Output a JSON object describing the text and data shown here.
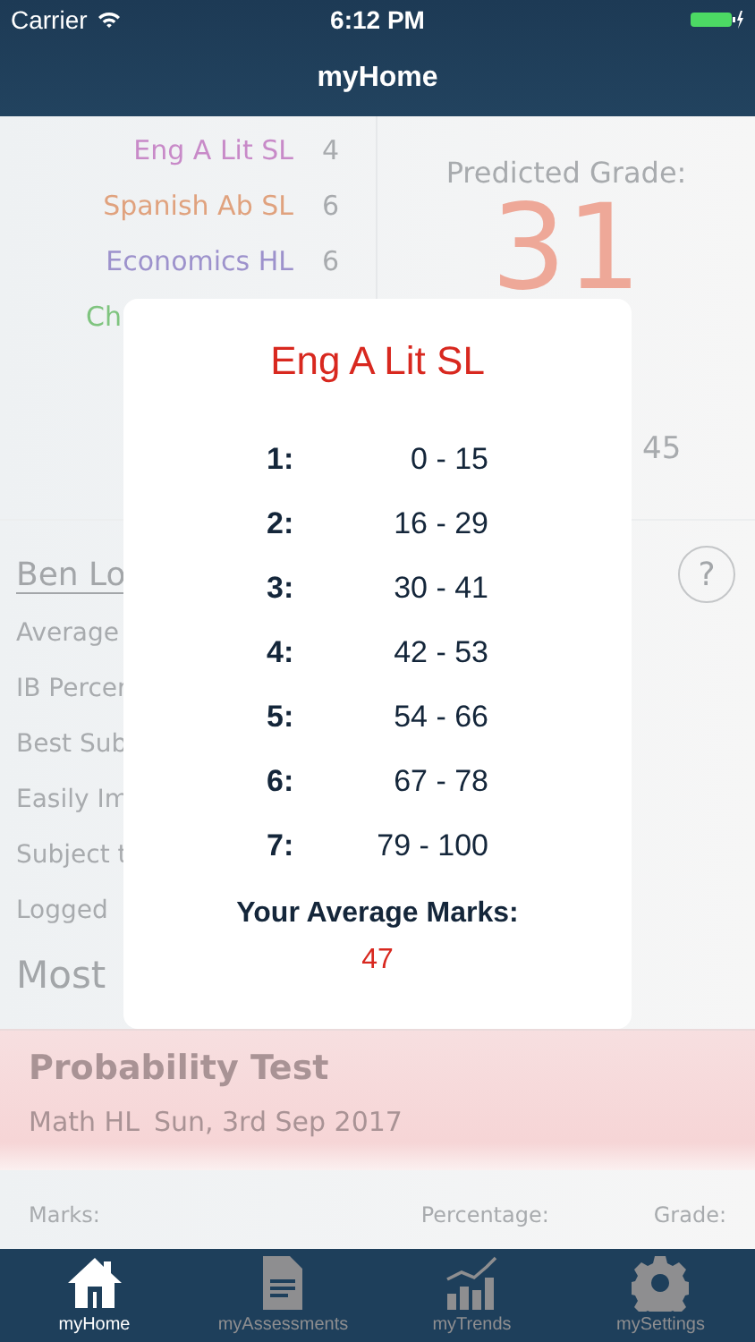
{
  "status_bar": {
    "carrier": "Carrier",
    "time": "6:12 PM"
  },
  "nav": {
    "title": "myHome"
  },
  "subjects": [
    {
      "name": "Eng A Lit SL",
      "grade": "4",
      "color": "#c88ac8"
    },
    {
      "name": "Spanish Ab SL",
      "grade": "6",
      "color": "#e0a27e"
    },
    {
      "name": "Economics HL",
      "grade": "6",
      "color": "#9d92cc"
    },
    {
      "name": "Ch",
      "color": "#7fc47f"
    }
  ],
  "prediction": {
    "label": "Predicted Grade:",
    "value": "31",
    "total": "45"
  },
  "student": {
    "name": "Ben Lo",
    "help": "?",
    "stats": [
      "Average",
      "IB Percer",
      "Best Sub",
      "Easily Im",
      "Subject t",
      "Logged"
    ]
  },
  "recent": {
    "heading": "Most",
    "title": "Probability Test",
    "subject": "Math HL",
    "date": "Sun, 3rd Sep 2017",
    "columns": [
      "Marks:",
      "Percentage:",
      "Grade:"
    ]
  },
  "dialog": {
    "title": "Eng A Lit SL",
    "boundaries": [
      {
        "grade": "1:",
        "range": "0 - 15"
      },
      {
        "grade": "2:",
        "range": "16 - 29"
      },
      {
        "grade": "3:",
        "range": "30 - 41"
      },
      {
        "grade": "4:",
        "range": "42 - 53"
      },
      {
        "grade": "5:",
        "range": "54 - 66"
      },
      {
        "grade": "6:",
        "range": "67 - 78"
      },
      {
        "grade": "7:",
        "range": "79 - 100"
      }
    ],
    "average_label": "Your Average Marks:",
    "average": "47"
  },
  "tabs": [
    {
      "label": "myHome",
      "kind": "home",
      "selected": true
    },
    {
      "label": "myAssessments",
      "kind": "document",
      "selected": false
    },
    {
      "label": "myTrends",
      "kind": "trends",
      "selected": false
    },
    {
      "label": "mySettings",
      "kind": "settings",
      "selected": false
    }
  ]
}
